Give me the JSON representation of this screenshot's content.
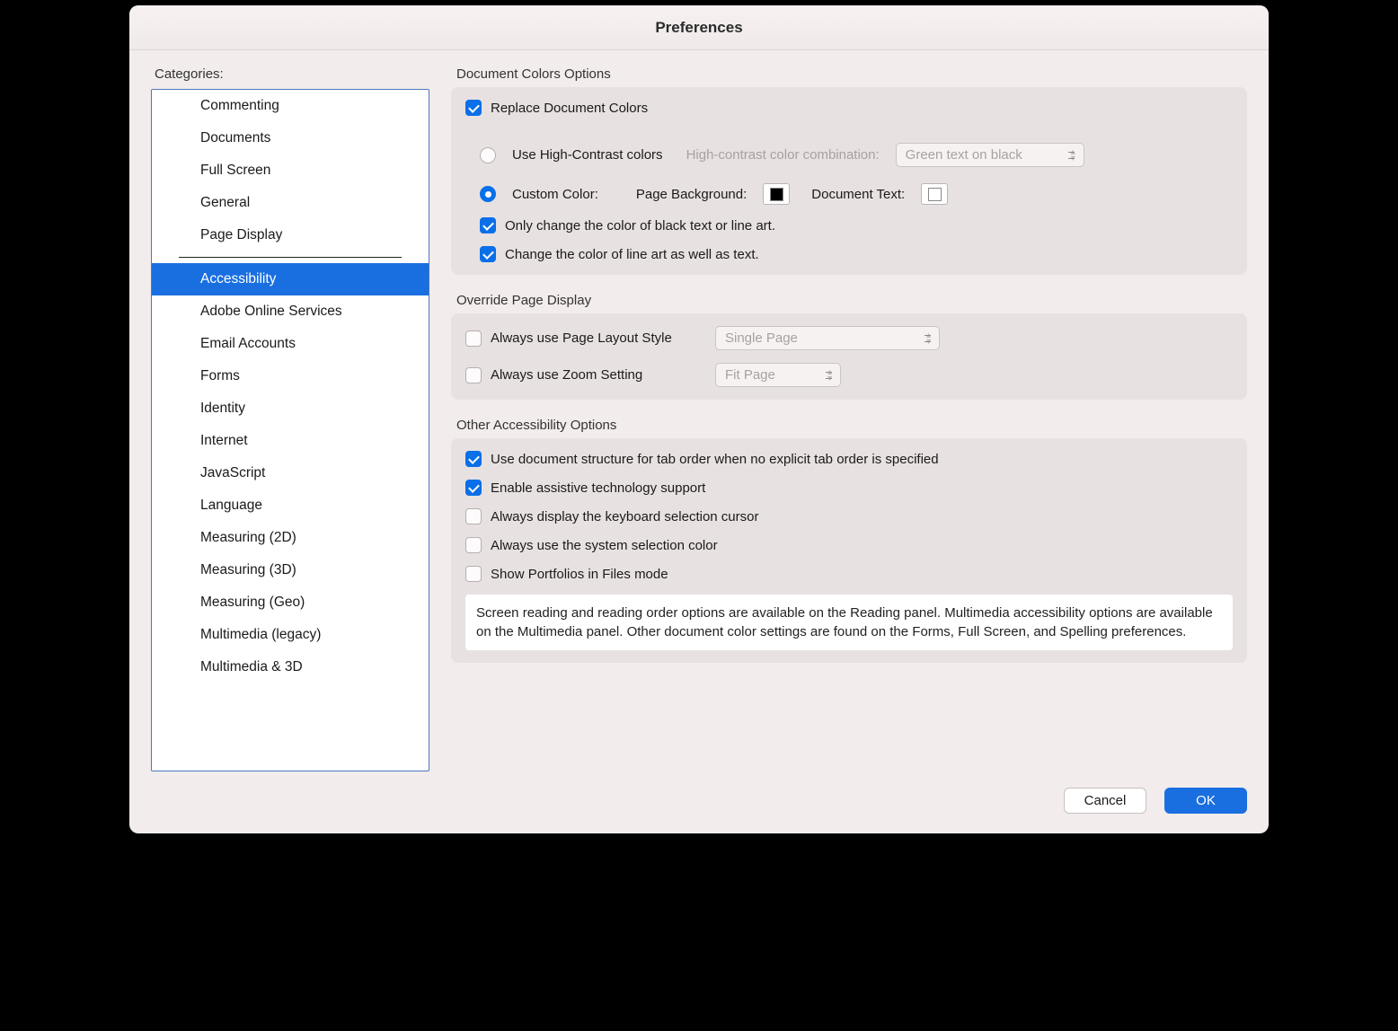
{
  "window": {
    "title": "Preferences"
  },
  "sidebar": {
    "label": "Categories:",
    "items": [
      "Commenting",
      "Documents",
      "Full Screen",
      "General",
      "Page Display",
      "Accessibility",
      "Adobe Online Services",
      "Email Accounts",
      "Forms",
      "Identity",
      "Internet",
      "JavaScript",
      "Language",
      "Measuring (2D)",
      "Measuring (3D)",
      "Measuring (Geo)",
      "Multimedia (legacy)",
      "Multimedia & 3D"
    ],
    "selected": "Accessibility",
    "divider_after_index": 4
  },
  "doc_colors": {
    "section_title": "Document Colors Options",
    "replace_label": "Replace Document Colors",
    "replace_checked": true,
    "radio_high_contrast_label": "Use High-Contrast colors",
    "high_contrast_combo_label": "High-contrast color combination:",
    "high_contrast_combo_value": "Green text on black",
    "radio_custom_label": "Custom Color:",
    "page_bg_label": "Page Background:",
    "page_bg_color": "#000000",
    "doc_text_label": "Document Text:",
    "doc_text_color": "#FFFFFF",
    "radio_selected": "custom",
    "only_black_label": "Only change the color of black text or line art.",
    "only_black_checked": true,
    "line_art_label": "Change the color of line art as well as text.",
    "line_art_checked": true
  },
  "override": {
    "section_title": "Override Page Display",
    "layout_label": "Always use Page Layout Style",
    "layout_checked": false,
    "layout_value": "Single Page",
    "zoom_label": "Always use Zoom Setting",
    "zoom_checked": false,
    "zoom_value": "Fit Page"
  },
  "other": {
    "section_title": "Other Accessibility Options",
    "tab_order_label": "Use document structure for tab order when no explicit tab order is specified",
    "tab_order_checked": true,
    "assistive_label": "Enable assistive technology support",
    "assistive_checked": true,
    "kb_cursor_label": "Always display the keyboard selection cursor",
    "kb_cursor_checked": false,
    "sys_sel_label": "Always use the system selection color",
    "sys_sel_checked": false,
    "portfolios_label": "Show Portfolios in Files mode",
    "portfolios_checked": false,
    "info_text": "Screen reading and reading order options are available on the Reading panel. Multimedia accessibility options are available on the Multimedia panel. Other document color settings are found on the Forms, Full Screen, and Spelling preferences."
  },
  "buttons": {
    "cancel": "Cancel",
    "ok": "OK"
  }
}
